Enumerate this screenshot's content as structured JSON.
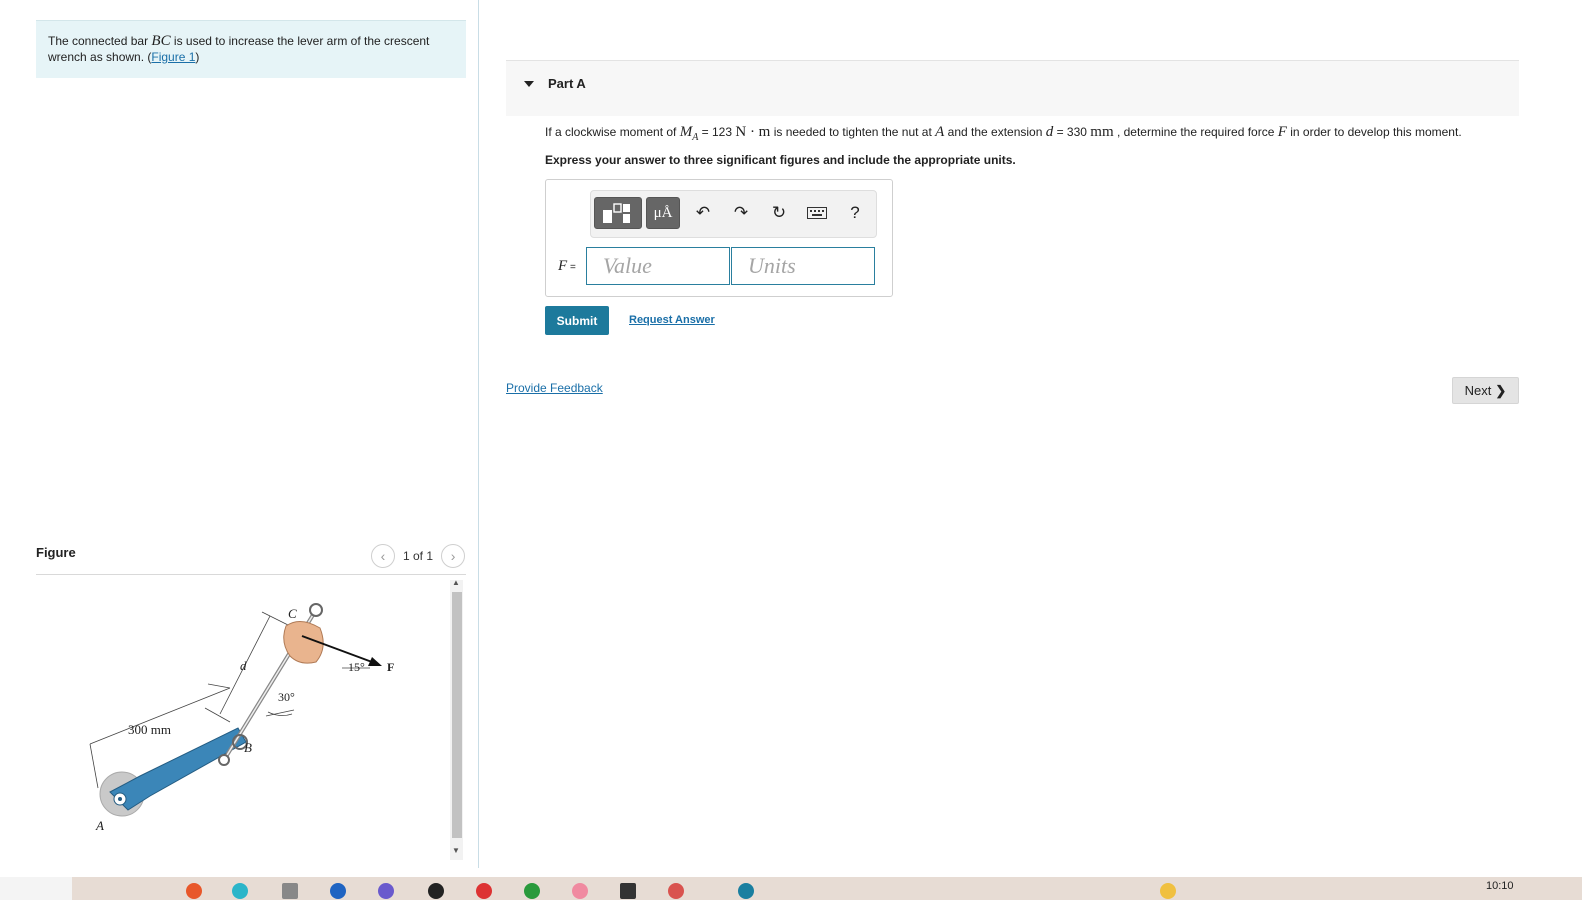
{
  "intro": {
    "text_before": "The connected bar ",
    "bar_name": "BC",
    "text_after": " is used to increase the lever arm of the crescent wrench as shown. (",
    "figure_link": "Figure 1",
    "text_end": ")"
  },
  "figure_panel": {
    "title": "Figure",
    "counter": "1 of 1",
    "prev_icon": "chevron-left-icon",
    "next_icon": "chevron-right-icon",
    "labels": {
      "c": "C",
      "d": "d",
      "f": "F",
      "angle15": "15°",
      "angle30": "30°",
      "dim300": "300 mm",
      "b": "B",
      "a": "A"
    }
  },
  "part": {
    "title": "Part A",
    "question": {
      "t1": "If a clockwise moment of ",
      "m_sym": "M",
      "m_sub": "A",
      "t2": " = 123 ",
      "m_unit": "N · m",
      "t3": " is needed to tighten the nut at ",
      "a_sym": "A",
      "t4": " and the extension ",
      "d_sym": "d",
      "t5": " = 330 ",
      "d_unit": "mm",
      "t6": " , determine the required force ",
      "f_sym": "F",
      "t7": " in order to develop this moment."
    },
    "instruction": "Express your answer to three significant figures and include the appropriate units."
  },
  "answer": {
    "label_sym": "F",
    "label_eq": " =",
    "value_placeholder": "Value",
    "units_placeholder": "Units",
    "toolbar": {
      "templates_icon": "templates-icon",
      "units_label": "μÅ",
      "undo_icon": "undo-icon",
      "redo_icon": "redo-icon",
      "reset_icon": "reset-icon",
      "keyboard_icon": "keyboard-icon",
      "help_label": "?"
    }
  },
  "actions": {
    "submit": "Submit",
    "request_answer": "Request Answer",
    "provide_feedback": "Provide Feedback",
    "next": "Next"
  },
  "taskbar": {
    "clock": "10:10"
  },
  "colors": {
    "accent": "#1d7a9c",
    "link": "#1a6fa8",
    "intro_bg": "#e6f4f7",
    "wrench": "#3b86b8"
  }
}
